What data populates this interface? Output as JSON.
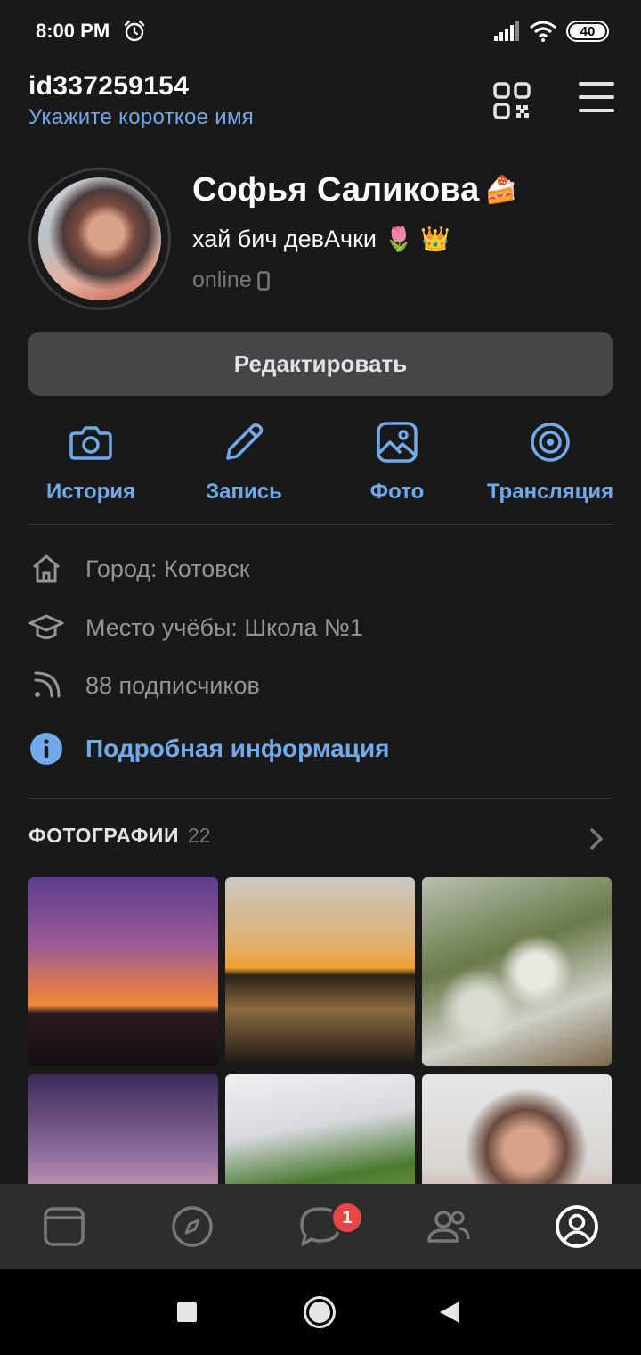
{
  "status_bar": {
    "time": "8:00 PM",
    "battery": "40"
  },
  "header": {
    "user_id": "id337259154",
    "short_name_prompt": "Укажите короткое имя"
  },
  "profile": {
    "name": "Софья Саликова",
    "name_emoji": "🍰",
    "status": "хай бич девАчки",
    "status_emoji": "🌷 👑",
    "online": "online"
  },
  "edit_button": "Редактировать",
  "actions": [
    {
      "label": "История",
      "icon": "camera-icon"
    },
    {
      "label": "Запись",
      "icon": "pencil-icon"
    },
    {
      "label": "Фото",
      "icon": "image-icon"
    },
    {
      "label": "Трансляция",
      "icon": "broadcast-icon"
    }
  ],
  "info": {
    "city": "Город: Котовск",
    "school": "Место учёбы: Школа №1",
    "followers": "88 подписчиков",
    "details_link": "Подробная информация"
  },
  "photos": {
    "title": "ФОТОГРАФИИ",
    "count": "22"
  },
  "tabbar": {
    "items": [
      "feed-icon",
      "explore-icon",
      "messages-icon",
      "friends-icon",
      "profile-icon"
    ],
    "messages_badge": "1",
    "active": "profile-icon"
  },
  "colors": {
    "accent": "#71aaeb",
    "background": "#19191a",
    "badge": "#e64646"
  }
}
